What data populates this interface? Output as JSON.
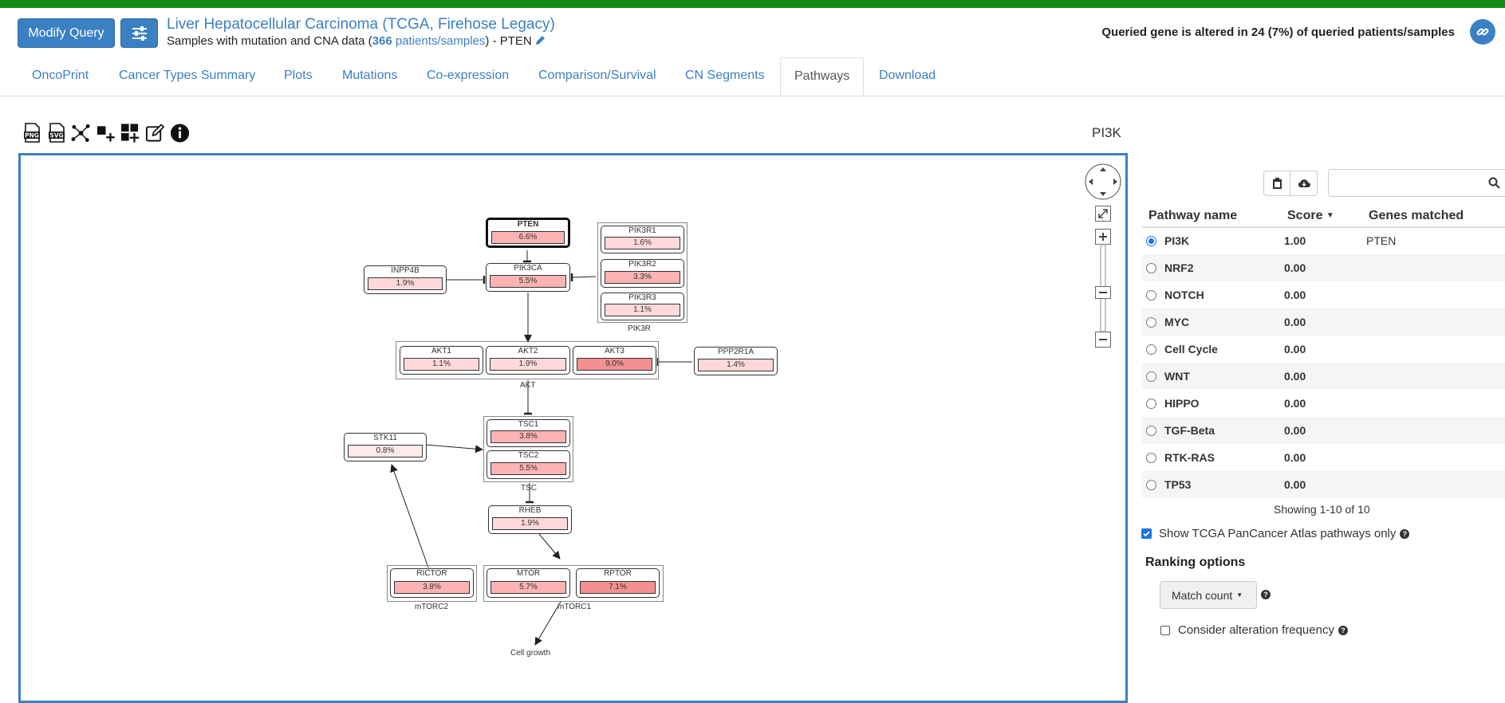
{
  "header": {
    "modify_query_label": "Modify Query",
    "study_title": "Liver Hepatocellular Carcinoma (TCGA, Firehose Legacy)",
    "samples_prefix": "Samples with mutation and CNA data (",
    "patient_count": "366",
    "patients_label": "patients/samples",
    "samples_suffix": ")  - PTEN",
    "altered_text": "Queried gene is altered in 24 (7%) of queried patients/samples"
  },
  "tabs": [
    {
      "label": "OncoPrint"
    },
    {
      "label": "Cancer Types Summary"
    },
    {
      "label": "Plots"
    },
    {
      "label": "Mutations"
    },
    {
      "label": "Co-expression"
    },
    {
      "label": "Comparison/Survival"
    },
    {
      "label": "CN Segments"
    },
    {
      "label": "Pathways",
      "active": true
    },
    {
      "label": "Download"
    }
  ],
  "toolbar": {
    "icons": [
      "png-download-icon",
      "svg-download-icon",
      "layout-icon",
      "add-node-icon",
      "add-group-icon",
      "edit-icon",
      "info-icon"
    ],
    "png_text": "PNG",
    "svg_text": "SVG"
  },
  "pathway_label": "PI3K",
  "graph": {
    "nodes": {
      "pten": {
        "name": "PTEN",
        "pct": "6.6%"
      },
      "pik3ca": {
        "name": "PIK3CA",
        "pct": "5.5%"
      },
      "inpp4b": {
        "name": "INPP4B",
        "pct": "1.9%"
      },
      "pik3r1": {
        "name": "PIK3R1",
        "pct": "1.6%"
      },
      "pik3r2": {
        "name": "PIK3R2",
        "pct": "3.3%"
      },
      "pik3r3": {
        "name": "PIK3R3",
        "pct": "1.1%"
      },
      "akt1": {
        "name": "AKT1",
        "pct": "1.1%"
      },
      "akt2": {
        "name": "AKT2",
        "pct": "1.9%"
      },
      "akt3": {
        "name": "AKT3",
        "pct": "9.0%"
      },
      "ppp2r1a": {
        "name": "PPP2R1A",
        "pct": "1.4%"
      },
      "stk11": {
        "name": "STK11",
        "pct": "0.8%"
      },
      "tsc1": {
        "name": "TSC1",
        "pct": "3.8%"
      },
      "tsc2": {
        "name": "TSC2",
        "pct": "5.5%"
      },
      "rheb": {
        "name": "RHEB",
        "pct": "1.9%"
      },
      "rictor": {
        "name": "RICTOR",
        "pct": "3.8%"
      },
      "mtor": {
        "name": "MTOR",
        "pct": "5.7%"
      },
      "rptor": {
        "name": "RPTOR",
        "pct": "7.1%"
      }
    },
    "groups": {
      "pik3r": "PIK3R",
      "akt": "AKT",
      "tsc": "TSC",
      "mtorc2": "mTORC2",
      "mtorc1": "mTORC1"
    },
    "cell_growth": "Cell growth"
  },
  "table": {
    "col_name": "Pathway name",
    "col_score": "Score",
    "col_genes": "Genes matched",
    "rows": [
      {
        "name": "PI3K",
        "score": "1.00",
        "genes": "PTEN",
        "selected": true
      },
      {
        "name": "NRF2",
        "score": "0.00",
        "genes": ""
      },
      {
        "name": "NOTCH",
        "score": "0.00",
        "genes": ""
      },
      {
        "name": "MYC",
        "score": "0.00",
        "genes": ""
      },
      {
        "name": "Cell Cycle",
        "score": "0.00",
        "genes": ""
      },
      {
        "name": "WNT",
        "score": "0.00",
        "genes": ""
      },
      {
        "name": "HIPPO",
        "score": "0.00",
        "genes": ""
      },
      {
        "name": "TGF-Beta",
        "score": "0.00",
        "genes": ""
      },
      {
        "name": "RTK-RAS",
        "score": "0.00",
        "genes": ""
      },
      {
        "name": "TP53",
        "score": "0.00",
        "genes": ""
      }
    ],
    "showing": "Showing 1-10 of 10"
  },
  "options": {
    "tcga_only_label": "Show TCGA PanCancer Atlas pathways only",
    "tcga_only_checked": true,
    "ranking_title": "Ranking options",
    "match_count_label": "Match count",
    "consider_freq_label": "Consider alteration frequency",
    "consider_freq_checked": false
  },
  "colors": {
    "brand_green": "#138a13",
    "primary_blue": "#3b80c3",
    "pct_light": "#ffd9d9",
    "pct_mid": "#fbb3b3",
    "pct_strong": "#f59090"
  }
}
